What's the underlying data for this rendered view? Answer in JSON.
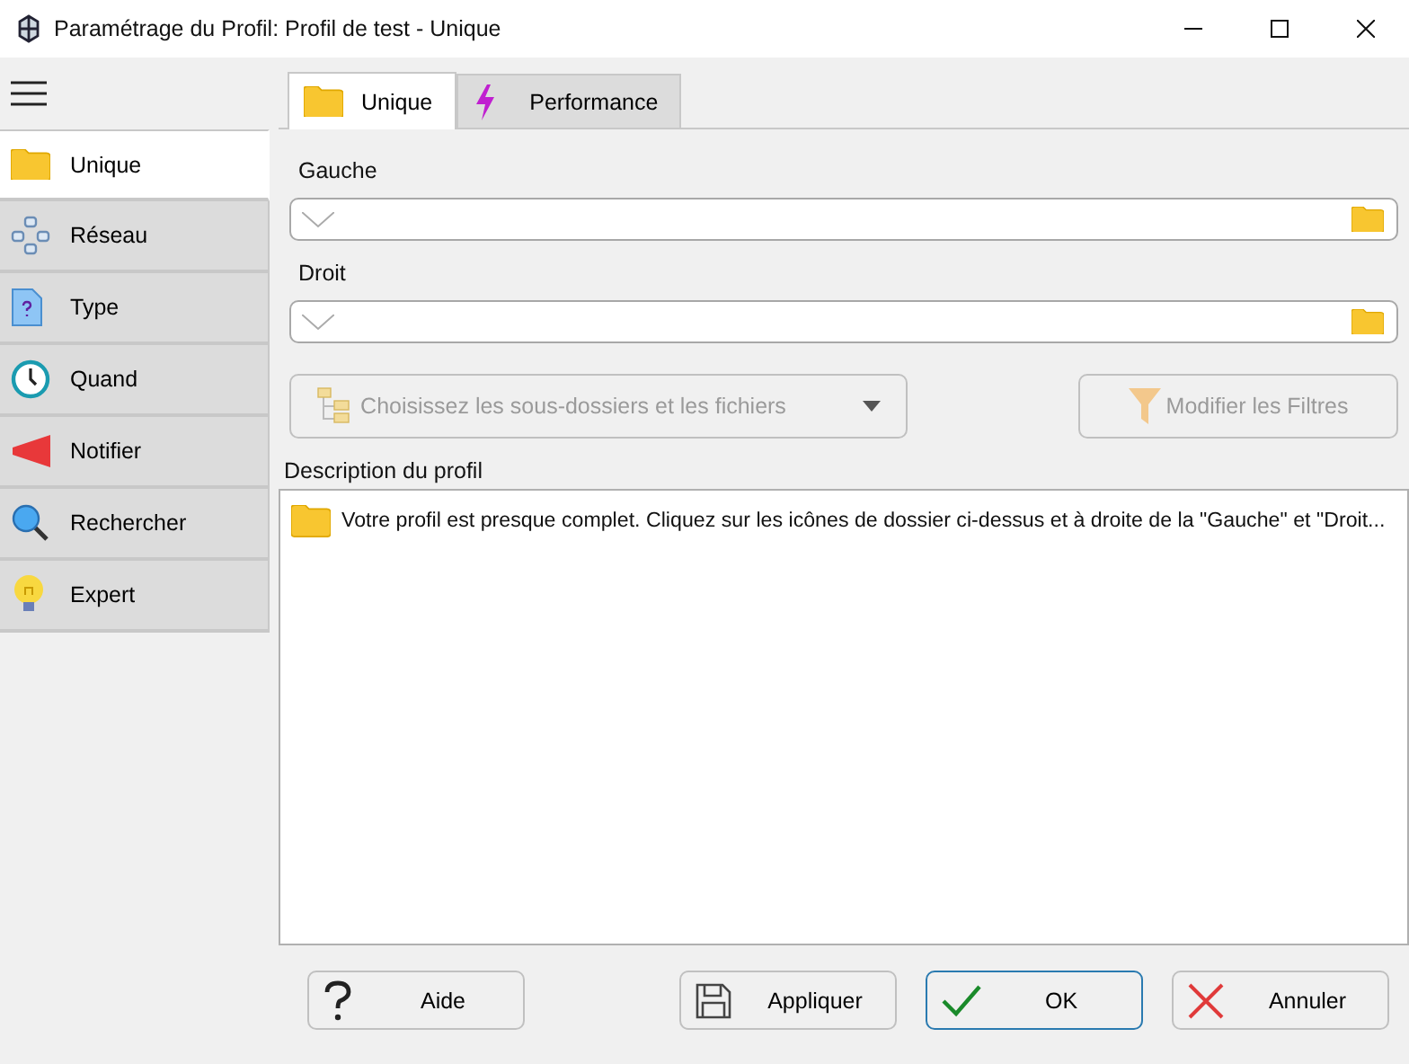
{
  "window": {
    "title": "Paramétrage du Profil: Profil de test - Unique"
  },
  "sidebar": {
    "items": [
      {
        "label": "Unique",
        "selected": true
      },
      {
        "label": "Réseau",
        "selected": false
      },
      {
        "label": "Type",
        "selected": false
      },
      {
        "label": "Quand",
        "selected": false
      },
      {
        "label": "Notifier",
        "selected": false
      },
      {
        "label": "Rechercher",
        "selected": false
      },
      {
        "label": "Expert",
        "selected": false
      }
    ]
  },
  "tabs": [
    {
      "label": "Unique",
      "selected": true
    },
    {
      "label": "Performance",
      "selected": false
    }
  ],
  "fields": [
    {
      "label": "Gauche"
    },
    {
      "label": "Droit"
    }
  ],
  "actions": [
    {
      "label": "Choisissez les sous-dossiers et les fichiers",
      "kind": "dropdown",
      "disabled": true
    },
    {
      "label": "Modifier les Filtres",
      "kind": "button",
      "disabled": true
    }
  ],
  "description": {
    "label": "Description du profil",
    "text": "Votre profil est presque complet. Cliquez sur les icônes de dossier ci-dessus et à droite de la \"Gauche\" et \"Droit..."
  },
  "buttons": [
    {
      "label": "Aide",
      "default": false
    },
    {
      "label": "Appliquer",
      "default": false
    },
    {
      "label": "OK",
      "default": true
    },
    {
      "label": "Annuler",
      "default": false
    }
  ]
}
